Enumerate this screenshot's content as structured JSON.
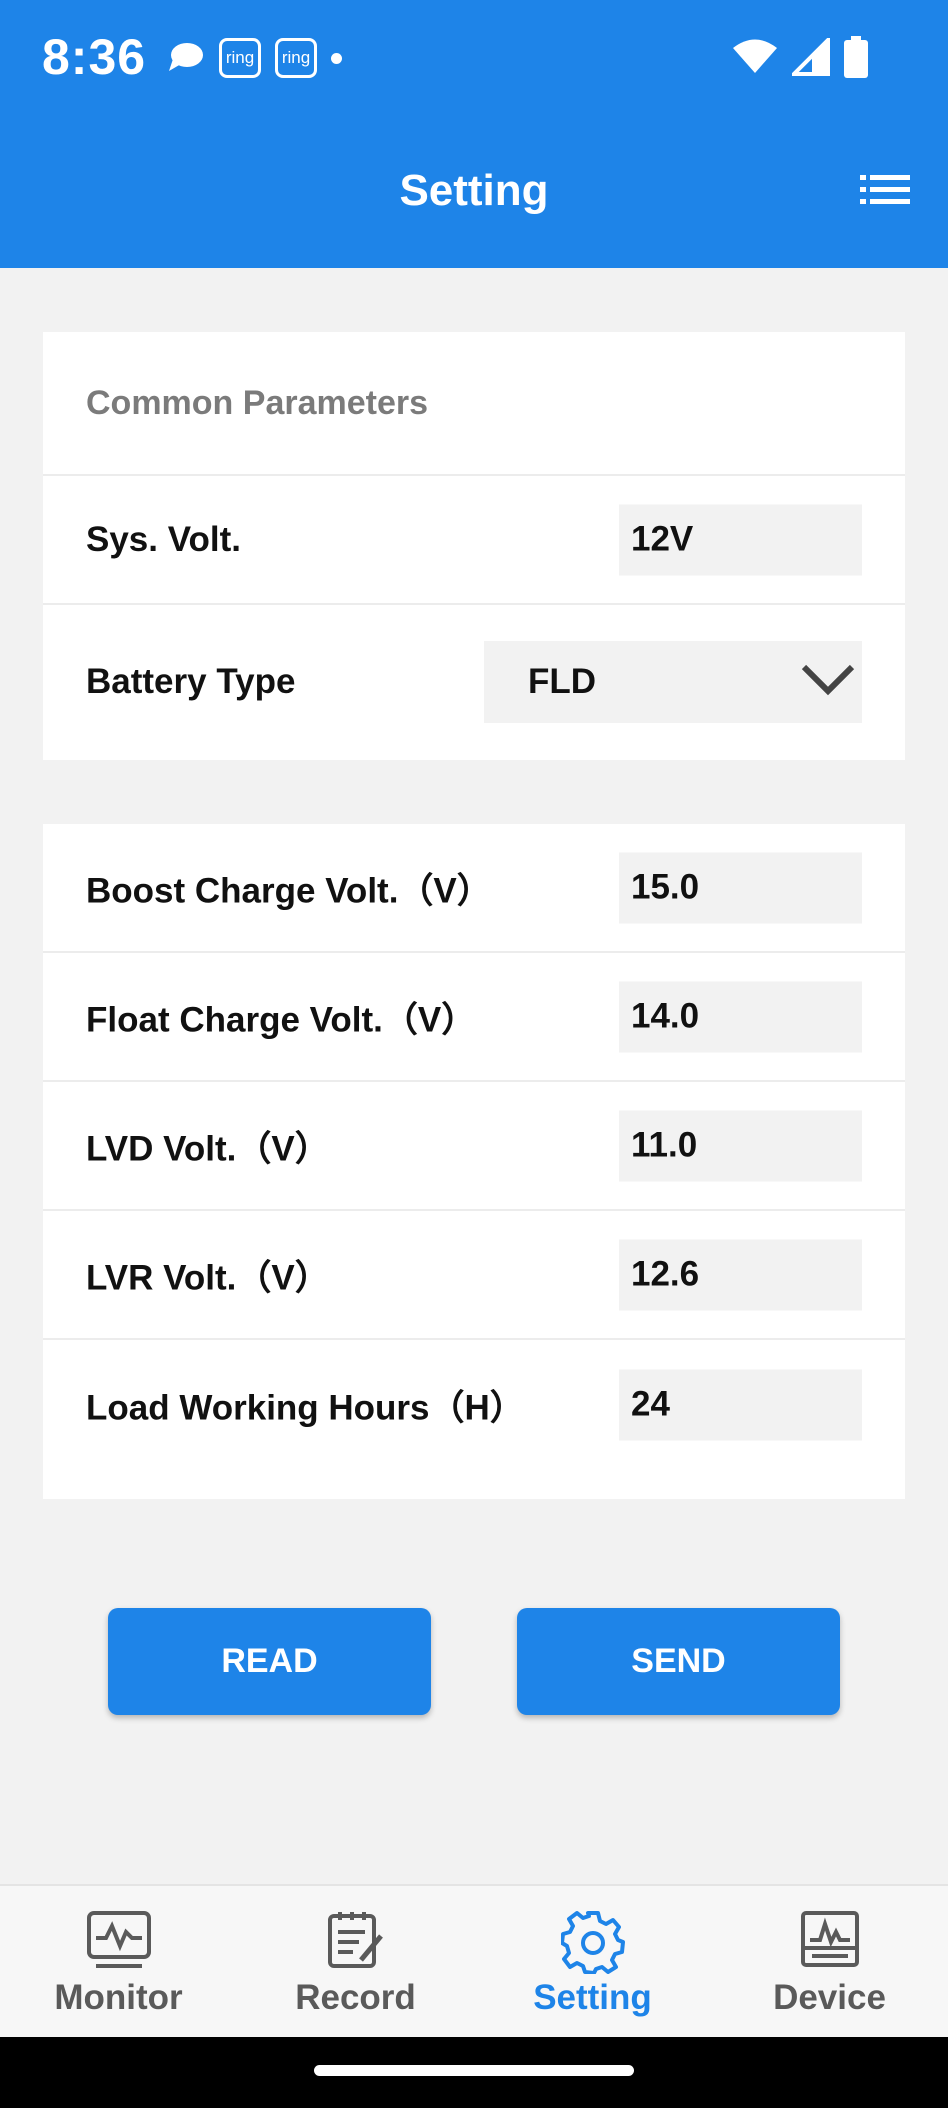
{
  "status_bar": {
    "time": "8:36",
    "ring_labels": [
      "ring",
      "ring"
    ]
  },
  "header": {
    "title": "Setting"
  },
  "common_parameters": {
    "title": "Common Parameters",
    "sys_volt": {
      "label": "Sys. Volt.",
      "value": "12V"
    },
    "battery_type": {
      "label": "Battery Type",
      "value": "FLD"
    }
  },
  "voltage_parameters": [
    {
      "label": "Boost Charge Volt.（V）",
      "value": "15.0"
    },
    {
      "label": "Float Charge Volt.（V）",
      "value": "14.0"
    },
    {
      "label": "LVD Volt.（V）",
      "value": "11.0"
    },
    {
      "label": "LVR Volt.（V）",
      "value": "12.6"
    },
    {
      "label": "Load Working Hours（H）",
      "value": "24"
    }
  ],
  "actions": {
    "read_label": "READ",
    "send_label": "SEND"
  },
  "bottom_nav": {
    "items": [
      {
        "label": "Monitor",
        "icon": "monitor-icon"
      },
      {
        "label": "Record",
        "icon": "record-icon"
      },
      {
        "label": "Setting",
        "icon": "gear-icon",
        "active": true
      },
      {
        "label": "Device",
        "icon": "device-icon"
      }
    ]
  },
  "colors": {
    "accent": "#1e84e8",
    "background": "#f2f2f2",
    "inactive_nav": "#5a5a5a"
  }
}
